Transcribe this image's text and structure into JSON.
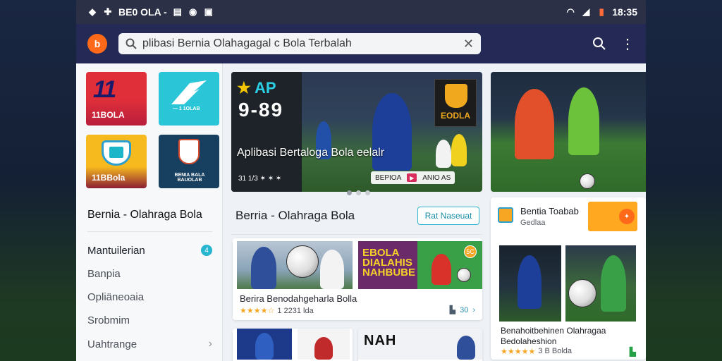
{
  "statusbar": {
    "left_text": "BE0 OLA -",
    "time": "18:35"
  },
  "appbar": {
    "logo_text": "b",
    "search_query": "plibasi Bernia Olahagagal c Bola Terbalah"
  },
  "sidebar": {
    "tiles": [
      {
        "big": "11",
        "caption": "11BOLA"
      },
      {
        "caption": "— 1 1OLAB"
      },
      {
        "caption": "11BBola"
      },
      {
        "caption": "BENIA BALA BAUOLAB"
      }
    ],
    "title": "Bernia - Olahraga Bola",
    "menu": [
      {
        "label": "Mantuilerian",
        "badge": "4"
      },
      {
        "label": "Banpia"
      },
      {
        "label": "Opliäneoaia"
      },
      {
        "label": "Srobmim"
      },
      {
        "label": "Uahtrange"
      }
    ]
  },
  "hero": {
    "logo_top": "AP",
    "logo_mid": "9-89",
    "emblem_text": "EODLA",
    "title": "Aplibasi Bertaloga Bola  eelalr",
    "meta": "31 1/3 ✶ ✶ ✶",
    "chip_left": "BEPIOA",
    "chip_right": "ANIO AS"
  },
  "section": {
    "title": "Berria - Olahraga Bola",
    "button": "Rat Naseuat"
  },
  "cards": {
    "main_title": "Berira Benodahgeharla Bolla",
    "main_rating": "★★★★☆",
    "main_rating_text": "1 2231 lda",
    "main_action": "30",
    "promo_text": "EBOLA DIALAHIS NAHBUBE",
    "promo_badge": "5C",
    "small1_text": "",
    "small2_text": "NAH"
  },
  "side": {
    "title": "Bentia Toabab",
    "subtitle": "Gedlaa",
    "promo_icon": "✦",
    "card_title": "Benahoitbehinen Olahragaa Bedolaheshion",
    "rating": "★★★★★",
    "rating_text": "3 B Bolda"
  },
  "colors": {
    "statusbar": "#2b3047",
    "appbar": "#242a55",
    "accent": "#2bb4cc",
    "star": "#f5a623"
  },
  "icons": [
    "wifi-icon",
    "signal-icon",
    "battery-icon",
    "search-icon",
    "close-icon",
    "more-vert-icon",
    "chevron-right-icon"
  ]
}
